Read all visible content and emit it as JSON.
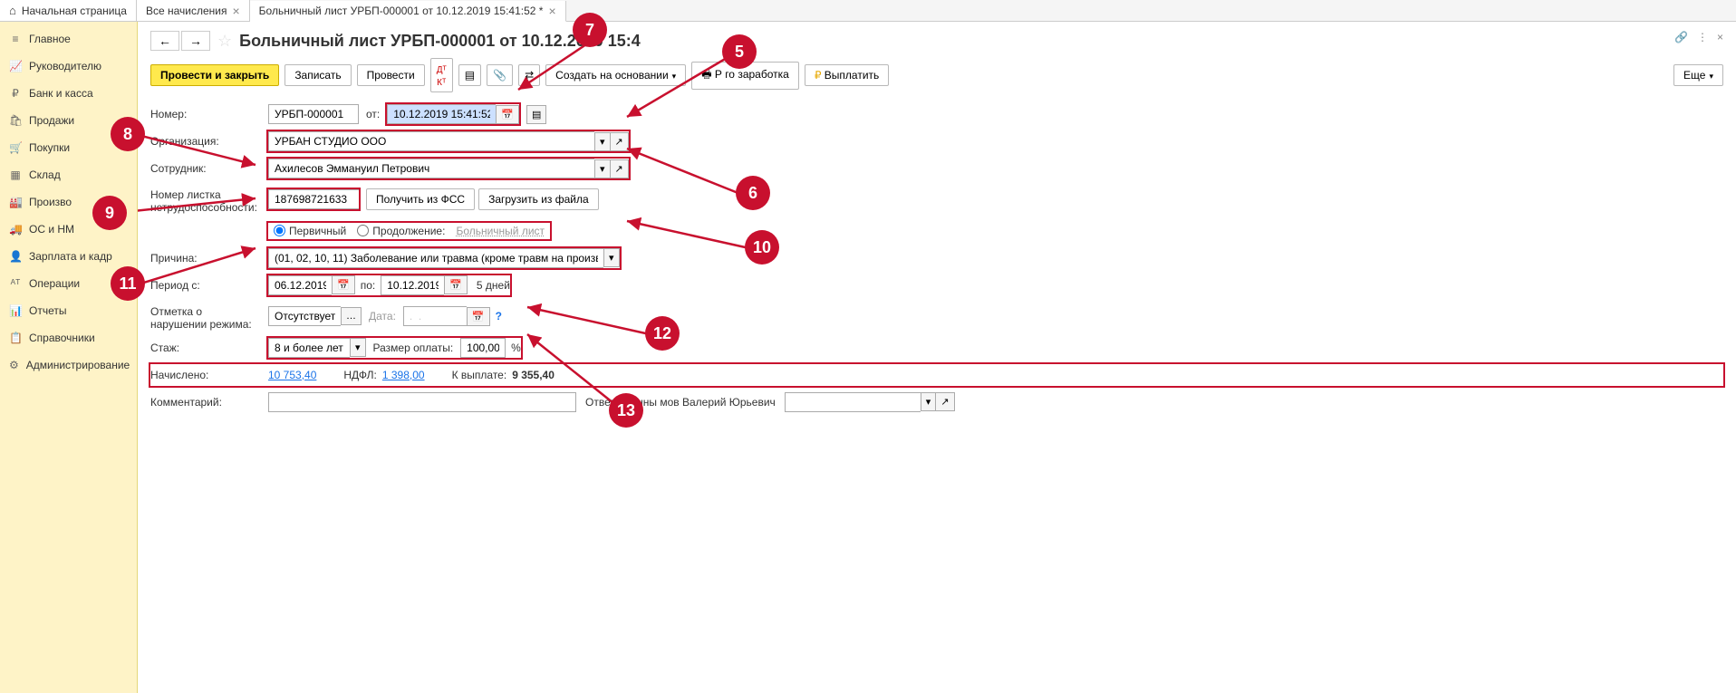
{
  "tabs": {
    "home": "Начальная страница",
    "all": "Все начисления",
    "doc": "Больничный лист УРБП-000001 от 10.12.2019 15:41:52 *"
  },
  "sidebar": {
    "items": [
      {
        "icon": "≡",
        "label": "Главное"
      },
      {
        "icon": "📈",
        "label": "Руководителю"
      },
      {
        "icon": "₽",
        "label": "Банк и касса"
      },
      {
        "icon": "🛍",
        "label": "Продажи"
      },
      {
        "icon": "🛒",
        "label": "Покупки"
      },
      {
        "icon": "▦",
        "label": "Склад"
      },
      {
        "icon": "🏭",
        "label": "Произво"
      },
      {
        "icon": "🚚",
        "label": "ОС и НМ"
      },
      {
        "icon": "👤",
        "label": "Зарплата и кадр"
      },
      {
        "icon": "ᴬᵀ",
        "label": "Операции"
      },
      {
        "icon": "📊",
        "label": "Отчеты"
      },
      {
        "icon": "📋",
        "label": "Справочники"
      },
      {
        "icon": "⚙",
        "label": "Администрирование"
      }
    ]
  },
  "doc": {
    "title": "Больничный лист УРБП-000001 от 10.12.2019 15:4"
  },
  "toolbar": {
    "post_close": "Провести и закрыть",
    "write": "Записать",
    "post": "Провести",
    "create_based": "Создать на основании",
    "print_earn": "Р                         го заработка",
    "pay": "Выплатить",
    "more": "Еще"
  },
  "form": {
    "number_label": "Номер:",
    "number": "УРБП-000001",
    "date_label": "от:",
    "date": "10.12.2019 15:41:52",
    "org_label": "Организация:",
    "org": "УРБАН СТУДИО ООО",
    "emp_label": "Сотрудник:",
    "emp": "Ахилесов Эммануил Петрович",
    "sheet_num_label": "Номер листка нетрудоспособности:",
    "sheet_num": "187698721633",
    "get_fss": "Получить из ФСС",
    "load_file": "Загрузить из файла",
    "primary": "Первичный",
    "continuation": "Продолжение:",
    "sick_link": "Больничный лист",
    "reason_label": "Причина:",
    "reason": "(01, 02, 10, 11) Заболевание или травма (кроме травм на производстве)",
    "period_label": "Период с:",
    "period_from": "06.12.2019",
    "period_to_label": "по:",
    "period_to": "10.12.2019",
    "period_days": "5 дней",
    "violation_label": "Отметка о нарушении режима:",
    "violation": "Отсутствует",
    "violation_date_label": "Дата:",
    "violation_date": ".  .",
    "seniority_label": "Стаж:",
    "seniority": "8 и более лет",
    "pay_size_label": "Размер оплаты:",
    "pay_size": "100,00",
    "pay_pct": "%",
    "accrued_label": "Начислено:",
    "accrued": "10 753,40",
    "ndfl_label": "НДФЛ:",
    "ndfl": "1 398,00",
    "to_pay_label": "К выплате:",
    "to_pay": "9 355,40",
    "comment_label": "Комментарий:",
    "responsible_label": "Ответственны                  мов Валерий Юрьевич"
  },
  "anno": {
    "5": "5",
    "6": "6",
    "7": "7",
    "8": "8",
    "9": "9",
    "10": "10",
    "11": "11",
    "12": "12",
    "13": "13"
  }
}
